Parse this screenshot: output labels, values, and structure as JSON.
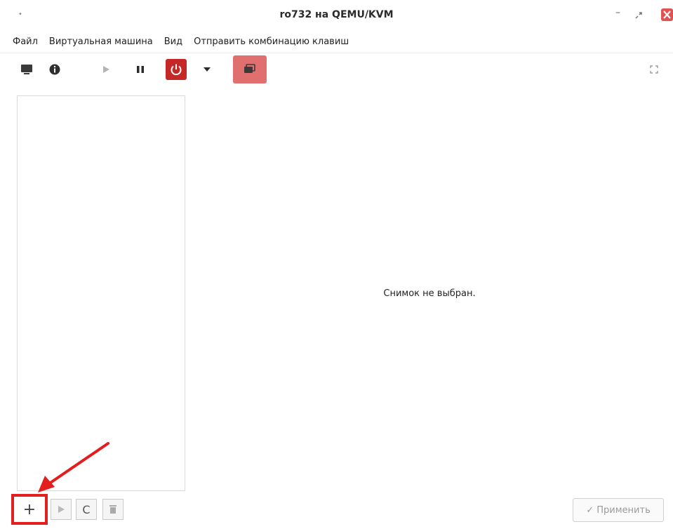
{
  "window": {
    "title": "ro732 на QEMU/KVM",
    "dot": "•",
    "minimize_glyph": "–"
  },
  "menu": {
    "items": [
      {
        "label": "Файл"
      },
      {
        "label": "Виртуальная машина"
      },
      {
        "label": "Вид"
      },
      {
        "label": "Отправить комбинацию клавиш"
      }
    ]
  },
  "toolbar": {
    "icons": [
      "monitor-icon",
      "info-icon",
      "play-icon",
      "pause-icon",
      "power-icon",
      "dropdown-icon",
      "snapshots-icon",
      "fullscreen-icon"
    ],
    "accent_power": "#c62828",
    "accent_snapshots": "#e07070"
  },
  "main": {
    "empty_message": "Снимок не выбран."
  },
  "bottom": {
    "add_label": "+",
    "refresh_label": "C",
    "apply_label": "✓ Применить",
    "highlight_color": "#e21e1e"
  }
}
